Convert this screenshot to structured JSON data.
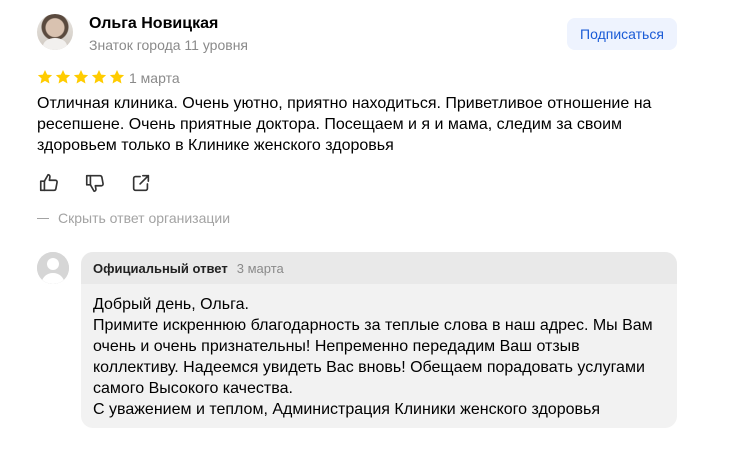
{
  "author": {
    "name": "Ольга Новицкая",
    "level": "Знаток города 11 уровня",
    "subscribe_label": "Подписаться"
  },
  "review": {
    "rating": 5,
    "rating_max": 5,
    "date": "1 марта",
    "text": "Отличная клиника. Очень уютно, приятно находиться. Приветливое отношение на ресепшене. Очень приятные доктора. Посещаем и я и мама, следим за своим здоровьем только в Клинике женского здоровья"
  },
  "actions": {
    "icons": [
      "thumbs-up-icon",
      "thumbs-down-icon",
      "share-icon"
    ]
  },
  "reply_toggle": {
    "label": "Скрыть ответ организации"
  },
  "reply": {
    "title": "Официальный ответ",
    "date": "3 марта",
    "lines": [
      "Добрый день, Ольга.",
      "Примите искреннюю благодарность за теплые слова в наш адрес. Мы Вам",
      "очень и очень признательны! Непременно передадим Ваш отзыв",
      "коллективу. Надеемся увидеть Вас вновь! Обещаем порадовать услугами",
      "самого Высокого качества.",
      "С уважением и теплом, Администрация Клиники женского здоровья"
    ]
  },
  "colors": {
    "star": "#ffcc00",
    "accent": "#1a5bd6",
    "muted": "#8a8a8a"
  }
}
